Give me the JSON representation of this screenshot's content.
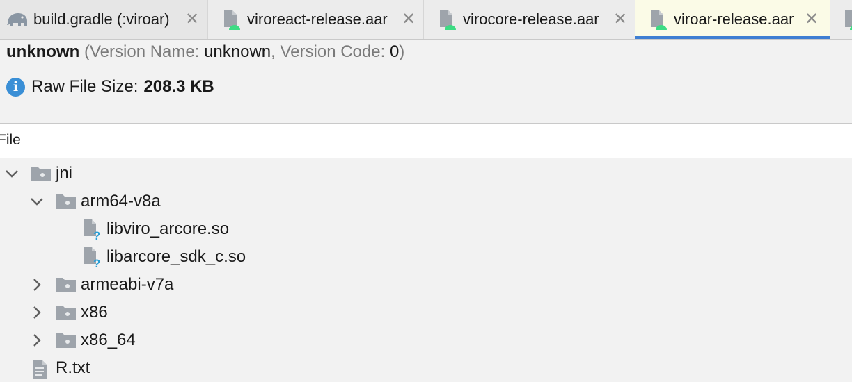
{
  "tabs": [
    {
      "label": "build.gradle (:viroar)",
      "icon": "gradle-elephant-icon",
      "active": false
    },
    {
      "label": "viroreact-release.aar",
      "icon": "android-archive-icon",
      "active": false
    },
    {
      "label": "virocore-release.aar",
      "icon": "android-archive-icon",
      "active": false
    },
    {
      "label": "viroar-release.aar",
      "icon": "android-archive-icon",
      "active": true
    }
  ],
  "close_glyph": "✕",
  "header": {
    "name": "unknown",
    "open_paren": "(",
    "version_name_label": "Version Name: ",
    "version_name": "unknown",
    "comma": ", ",
    "version_code_label": "Version Code: ",
    "version_code": "0",
    "close_paren": ")"
  },
  "info": {
    "icon": "info-icon",
    "glyph": "i",
    "label": "Raw File Size:",
    "size": "208.3 KB"
  },
  "table": {
    "column_file": "File"
  },
  "tree": [
    {
      "label": "jni",
      "type": "folder",
      "expanded": true
    },
    {
      "label": "arm64-v8a",
      "type": "folder",
      "expanded": true
    },
    {
      "label": "libviro_arcore.so",
      "type": "unknown-file"
    },
    {
      "label": "libarcore_sdk_c.so",
      "type": "unknown-file"
    },
    {
      "label": "armeabi-v7a",
      "type": "folder",
      "expanded": false
    },
    {
      "label": "x86",
      "type": "folder",
      "expanded": false
    },
    {
      "label": "x86_64",
      "type": "folder",
      "expanded": false
    },
    {
      "label": "R.txt",
      "type": "text-file"
    }
  ],
  "colors": {
    "accent": "#3f7fd2",
    "android_green": "#3ddc84",
    "info_blue": "#3a8fd6",
    "folder_gray": "#9ea4ab"
  }
}
